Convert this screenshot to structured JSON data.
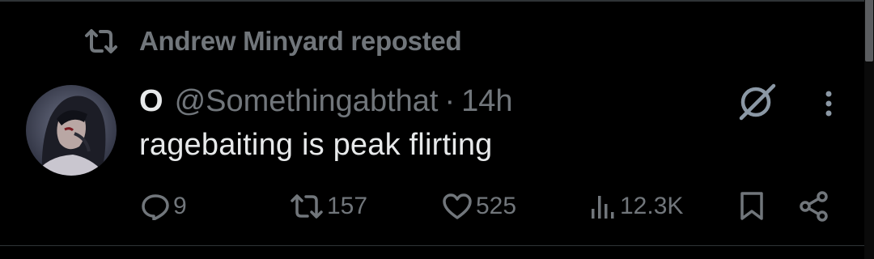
{
  "repost_banner": {
    "icon": "repost-icon",
    "text": "Andrew Minyard reposted"
  },
  "tweet": {
    "display_name": "O",
    "handle": "@Somethingabthat",
    "separator": "·",
    "time": "14h",
    "text": "ragebaiting is peak flirting",
    "avatar": "avatar-image"
  },
  "actions": {
    "replies": "9",
    "reposts": "157",
    "likes": "525",
    "views": "12.3K"
  },
  "colors": {
    "background": "#000000",
    "primary_text": "#e7e9ea",
    "secondary_text": "#71767b",
    "divider": "#2f3336"
  }
}
